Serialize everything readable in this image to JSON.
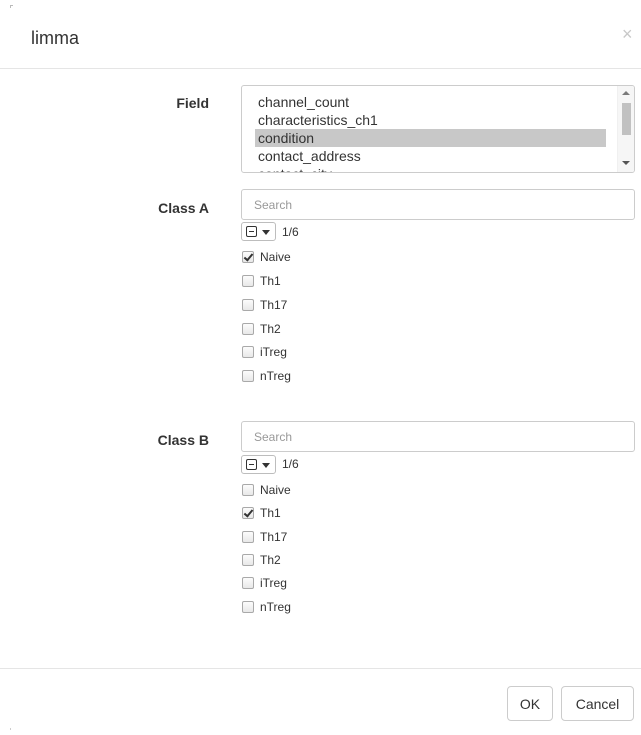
{
  "modal": {
    "title": "limma",
    "close_symbol": "×"
  },
  "field": {
    "label": "Field",
    "options": [
      "channel_count",
      "characteristics_ch1",
      "condition",
      "contact_address",
      "contact_city"
    ],
    "selected": "condition"
  },
  "class_a": {
    "label": "Class A",
    "search_placeholder": "Search",
    "count": "1/6",
    "items": [
      {
        "label": "Naive",
        "checked": true
      },
      {
        "label": "Th1",
        "checked": false
      },
      {
        "label": "Th17",
        "checked": false
      },
      {
        "label": "Th2",
        "checked": false
      },
      {
        "label": "iTreg",
        "checked": false
      },
      {
        "label": "nTreg",
        "checked": false
      }
    ]
  },
  "class_b": {
    "label": "Class B",
    "search_placeholder": "Search",
    "count": "1/6",
    "items": [
      {
        "label": "Naive",
        "checked": false
      },
      {
        "label": "Th1",
        "checked": true
      },
      {
        "label": "Th17",
        "checked": false
      },
      {
        "label": "Th2",
        "checked": false
      },
      {
        "label": "iTreg",
        "checked": false
      },
      {
        "label": "nTreg",
        "checked": false
      }
    ]
  },
  "footer": {
    "ok_label": "OK",
    "cancel_label": "Cancel"
  }
}
